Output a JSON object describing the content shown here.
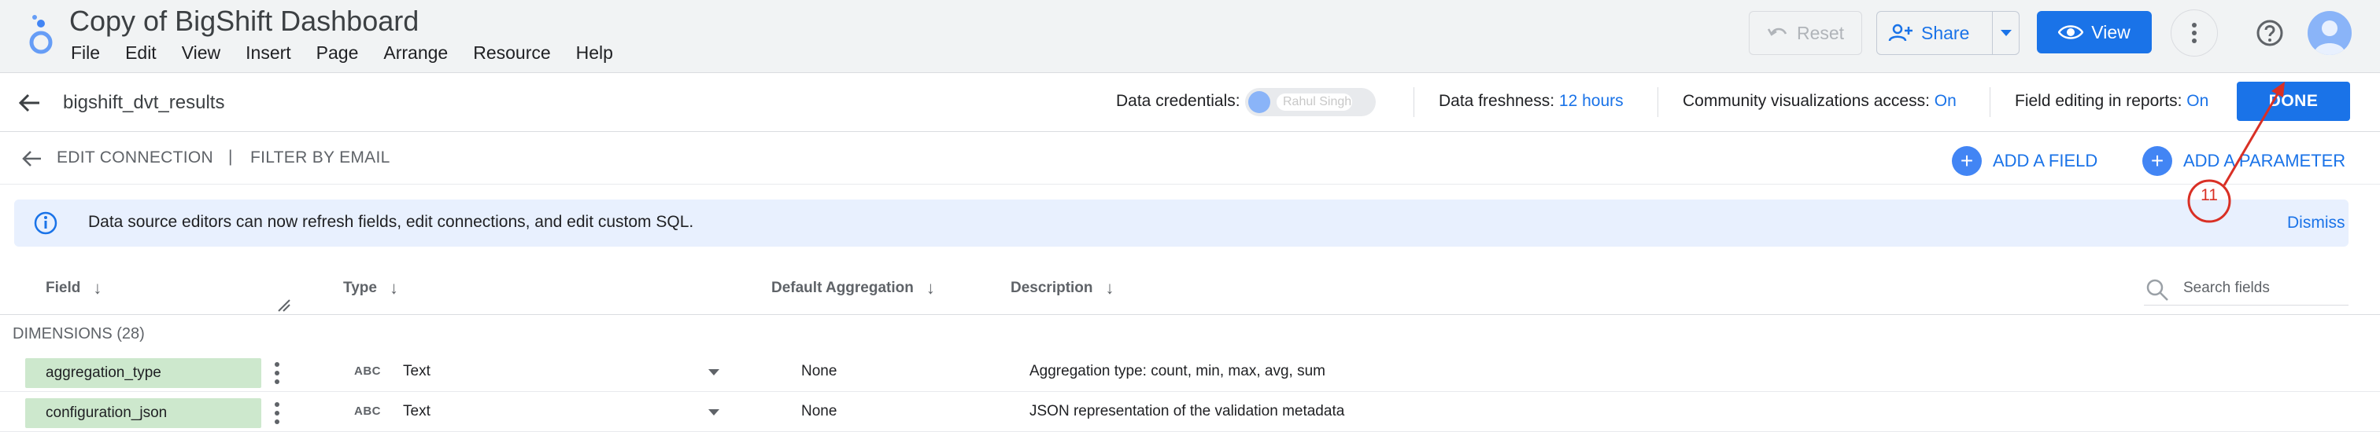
{
  "app": {
    "title": "Copy of BigShift Dashboard",
    "menu": [
      "File",
      "Edit",
      "View",
      "Insert",
      "Page",
      "Arrange",
      "Resource",
      "Help"
    ],
    "reset_label": "Reset",
    "share_label": "Share",
    "view_label": "View"
  },
  "datasource": {
    "name": "bigshift_dvt_results",
    "credentials_label": "Data credentials:",
    "credentials_user": "Rahul Singh",
    "freshness_label": "Data freshness:",
    "freshness_value": "12 hours",
    "community_label": "Community visualizations access:",
    "community_value": "On",
    "editing_label": "Field editing in reports:",
    "editing_value": "On",
    "done_label": "DONE"
  },
  "editbar": {
    "edit_connection": "EDIT CONNECTION",
    "separator": "|",
    "filter_by_email": "FILTER BY EMAIL",
    "add_field": "ADD A FIELD",
    "add_parameter": "ADD A PARAMETER"
  },
  "banner": {
    "text": "Data source editors can now refresh fields, edit connections, and edit custom SQL.",
    "dismiss": "Dismiss"
  },
  "table": {
    "columns": {
      "field": "Field",
      "type": "Type",
      "aggregation": "Default Aggregation",
      "description": "Description"
    },
    "search_placeholder": "Search fields",
    "dimensions_label": "DIMENSIONS (28)",
    "rows": [
      {
        "field": "aggregation_type",
        "type_icon": "ABC",
        "type": "Text",
        "aggregation": "None",
        "description": "Aggregation type: count, min, max, avg, sum"
      },
      {
        "field": "configuration_json",
        "type_icon": "ABC",
        "type": "Text",
        "aggregation": "None",
        "description": "JSON representation of the validation metadata"
      }
    ]
  },
  "annotation": {
    "step": "11",
    "color": "#d93025"
  },
  "colors": {
    "accent": "#1a73e8",
    "field_chip": "#cde8cd",
    "banner_bg": "#e8f0fe"
  }
}
